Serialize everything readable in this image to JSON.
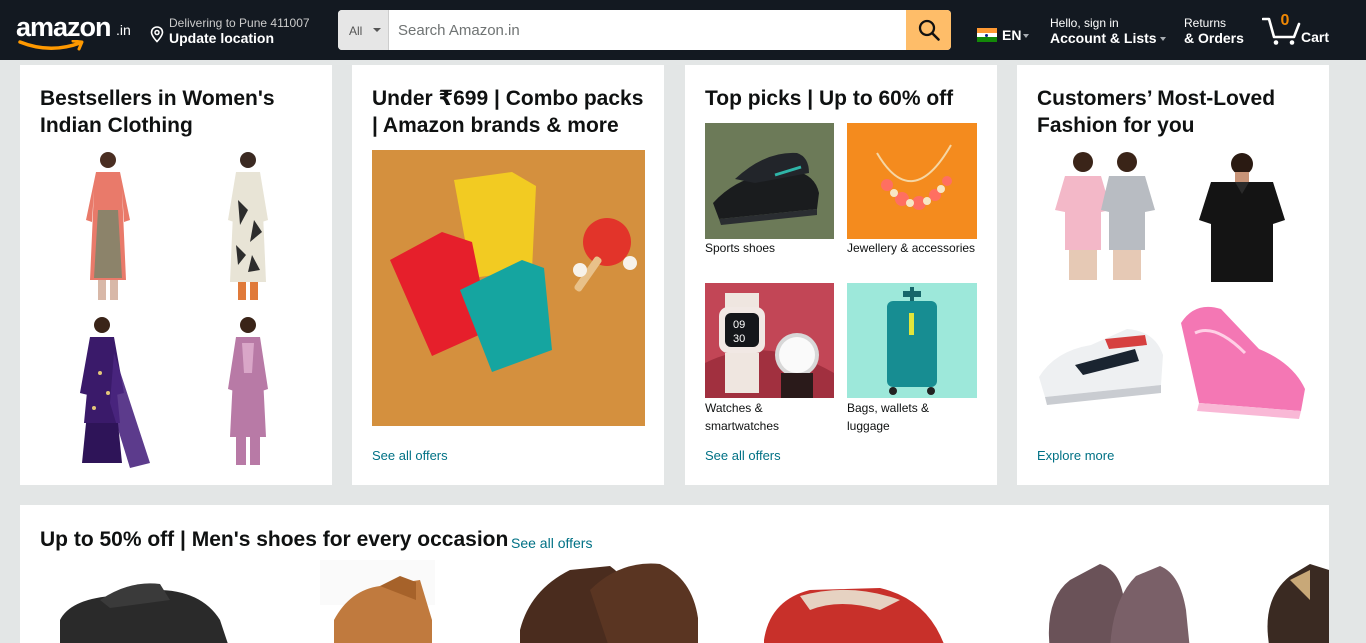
{
  "header": {
    "logo_text": "amazon",
    "logo_tld": ".in",
    "location_line1": "Delivering to Pune 411007",
    "location_line2": "Update location",
    "search": {
      "category": "All",
      "placeholder": "Search Amazon.in",
      "value": ""
    },
    "language": "EN",
    "account_line1": "Hello, sign in",
    "account_line2": "Account & Lists",
    "returns_line1": "Returns",
    "returns_line2": "& Orders",
    "cart_count": "0",
    "cart_label": "Cart",
    "colors": {
      "bar": "#131921",
      "search_button": "#febd69",
      "cart_count": "#f08804"
    }
  },
  "cards": [
    {
      "title": "Bestsellers in Women's Indian Clothing",
      "link": ""
    },
    {
      "title": "Under ₹699 | Combo packs | Amazon brands & more",
      "link": "See all offers"
    },
    {
      "title": "Top picks | Up to 60% off",
      "link": "See all offers",
      "tiles": [
        "Sports shoes",
        "Jewellery & accessories",
        "Watches & smartwatches",
        "Bags, wallets & luggage"
      ]
    },
    {
      "title": "Customers’ Most-Loved Fashion for you",
      "link": "Explore more"
    }
  ],
  "shoes_row": {
    "title": "Up to 50% off | Men's shoes for every occasion",
    "link": "See all offers"
  }
}
